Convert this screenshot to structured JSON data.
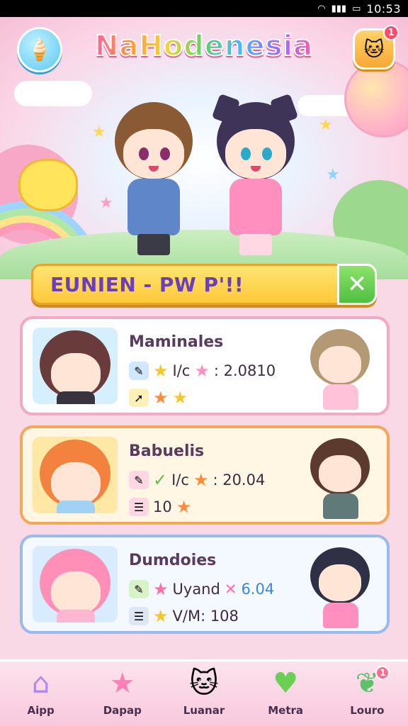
{
  "status_bar": {
    "time": "10:53"
  },
  "header": {
    "app_title": "NaHodenesia",
    "notification_count": "1"
  },
  "banner": {
    "text": "EUNIEN - PW P'!!",
    "close_glyph": "✕"
  },
  "cards": [
    {
      "title": "Maminales",
      "stat1": "I/c",
      "stat1_value": ": 2.0810",
      "theme": "#dff3ff",
      "border": "#f2a9c4"
    },
    {
      "title": "Babuelis",
      "stat1": "I/c",
      "stat1_value": ": 20.04",
      "stat2_value": "10",
      "theme": "#fff3d1",
      "border": "#f5a65a"
    },
    {
      "title": "Dumdoies",
      "stat1": "Uyand",
      "stat1_value": "6.04",
      "stat2": "V/M: 108",
      "theme": "#e6f1ff",
      "border": "#9ab9ec"
    }
  ],
  "tabs": [
    {
      "label": "Aipp",
      "icon": "house-icon"
    },
    {
      "label": "Dapap",
      "icon": "star-icon"
    },
    {
      "label": "Luanar",
      "icon": "cat-icon"
    },
    {
      "label": "Metra",
      "icon": "heart-icon",
      "badge": ""
    },
    {
      "label": "Louro",
      "icon": "leaf-icon",
      "badge": "1"
    }
  ],
  "colors": {
    "accent_pink": "#ff5fa2",
    "banner_yellow": "#ffc93a",
    "close_green": "#4fbf3f"
  }
}
